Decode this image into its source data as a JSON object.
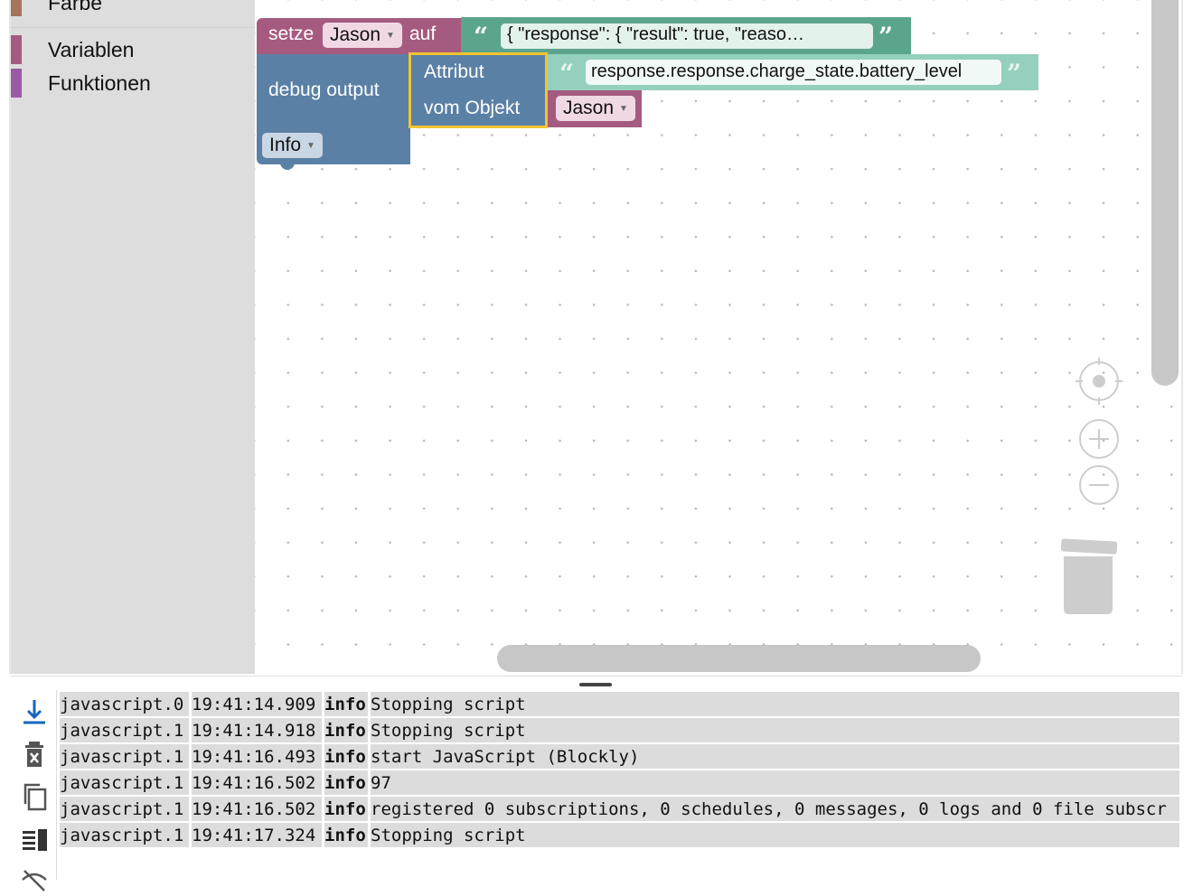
{
  "toolbox": {
    "categories": [
      {
        "label": "Farbe",
        "color": "#a5745b"
      },
      {
        "label": "Variablen",
        "color": "#a55b80"
      },
      {
        "label": "Funktionen",
        "color": "#995ba5"
      }
    ]
  },
  "blocks": {
    "set": {
      "keyword": "setze",
      "variable": "Jason",
      "to": "auf",
      "color": "#a55b80"
    },
    "text": {
      "value": "{   \"response\": {     \"result\": true,     \"reaso…",
      "color": "#5ba58c"
    },
    "debug": {
      "label": "debug output",
      "level": "Info",
      "color": "#5b80a5"
    },
    "attribute": {
      "label_attr": "Attribut",
      "label_obj": "vom Objekt",
      "path": "response.response.charge_state.battery_level",
      "object_var": "Jason"
    }
  },
  "log": {
    "rows": [
      {
        "source": "javascript.0",
        "time": "19:41:14.909",
        "severity": "info",
        "message": "Stopping script"
      },
      {
        "source": "javascript.1",
        "time": "19:41:14.918",
        "severity": "info",
        "message": "Stopping script"
      },
      {
        "source": "javascript.1",
        "time": "19:41:16.493",
        "severity": "info",
        "message": "start JavaScript (Blockly)"
      },
      {
        "source": "javascript.1",
        "time": "19:41:16.502",
        "severity": "info",
        "message": "97"
      },
      {
        "source": "javascript.1",
        "time": "19:41:16.502",
        "severity": "info",
        "message": "registered 0 subscriptions, 0 schedules, 0 messages, 0 logs and 0 file subscr"
      },
      {
        "source": "javascript.1",
        "time": "19:41:17.324",
        "severity": "info",
        "message": "Stopping script"
      }
    ]
  }
}
